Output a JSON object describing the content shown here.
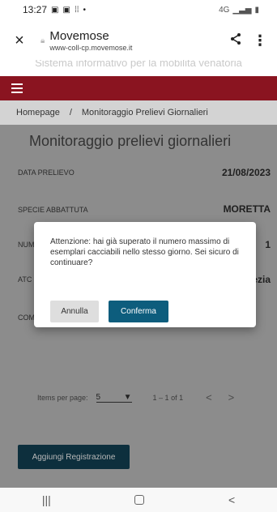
{
  "status_bar": {
    "time": "13:27",
    "notification_icons": [
      "image-icon",
      "image-icon",
      "dots-icon",
      "dot"
    ],
    "right_icons": [
      "network-icon",
      "signal-icon",
      "battery-icon"
    ],
    "network_text": "4G"
  },
  "browser": {
    "title": "Movemose",
    "url": "www-coll-cp.movemose.it",
    "close_label": "×",
    "share_label": "share",
    "more_label": "⋮"
  },
  "header": {
    "subtitle": "Sistema informativo per la mobilità venatoria"
  },
  "breadcrumb": {
    "home": "Homepage",
    "separator": "/",
    "current": "Monitoraggio Prelievi Giornalieri"
  },
  "page": {
    "title": "Monitoraggio prelievi giornalieri",
    "fields": [
      {
        "label": "DATA PRELIEVO",
        "value": "21/08/2023"
      },
      {
        "label": "SPECIE ABBATTUTA",
        "value": "MORETTA"
      },
      {
        "label": "NUM",
        "value": "1"
      },
      {
        "label": "ATC",
        "value": "ezia"
      },
      {
        "label": "COM",
        "value": ""
      }
    ]
  },
  "paginator": {
    "items_per_page_label": "Items per page:",
    "items_per_page_value": "5",
    "range_label": "1 – 1 of 1",
    "prev": "<",
    "next": ">"
  },
  "add_button": "Aggiungi Registrazione",
  "dialog": {
    "message": "Attenzione: hai già superato il numero massimo di esemplari cacciabili nello stesso giorno. Sei sicuro di continuare?",
    "cancel_label": "Annulla",
    "confirm_label": "Conferma"
  },
  "android_nav": {
    "recents": "|||",
    "back": "<"
  },
  "colors": {
    "nav_bar": "#8a1420",
    "overlay": "#8c8c8c",
    "confirm_button": "#0d5d7d",
    "add_button": "#0d2f3d"
  }
}
